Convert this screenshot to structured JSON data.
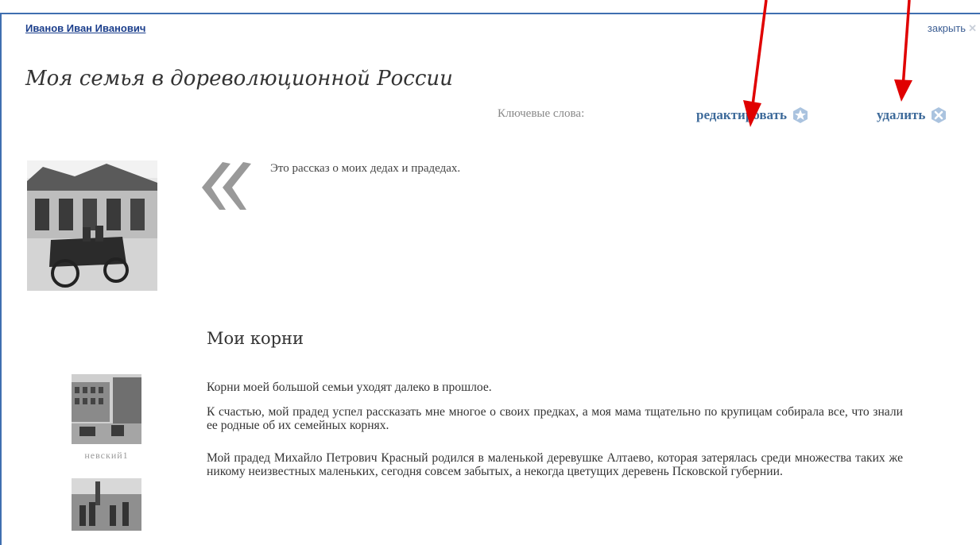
{
  "header": {
    "author": "Иванов Иван Иванович",
    "close_label": "закрыть",
    "close_glyph": "✕"
  },
  "story": {
    "title": "Моя семья в дореволюционной России",
    "keywords_label": "Ключевые слова:",
    "edit_label": "редактировать",
    "delete_label": "удалить",
    "lead": "Это рассказ о моих дедах и прадедах."
  },
  "section": {
    "title": "Мои корни",
    "paragraphs": [
      "Корни моей большой семьи уходят далеко в прошлое.",
      "К счастью, мой прадед успел рассказать мне многое о своих предках, а моя мама тщательно по крупицам собирала все, что знали ее родные об их семейных корнях.",
      "Мой прадед Михайло Петрович Красный родился в маленькой деревушке Алтаево, которая затерялась среди множества таких же никому неизвестных маленьких, сегодня совсем забытых, а некогда цветущих деревень Псковской губернии."
    ]
  },
  "gallery": {
    "thumb1_caption": "невский1"
  },
  "colors": {
    "frame_border": "#3f6fb0",
    "link": "#1c3f8c",
    "action": "#3d6a9a",
    "arrow": "#e00000"
  }
}
